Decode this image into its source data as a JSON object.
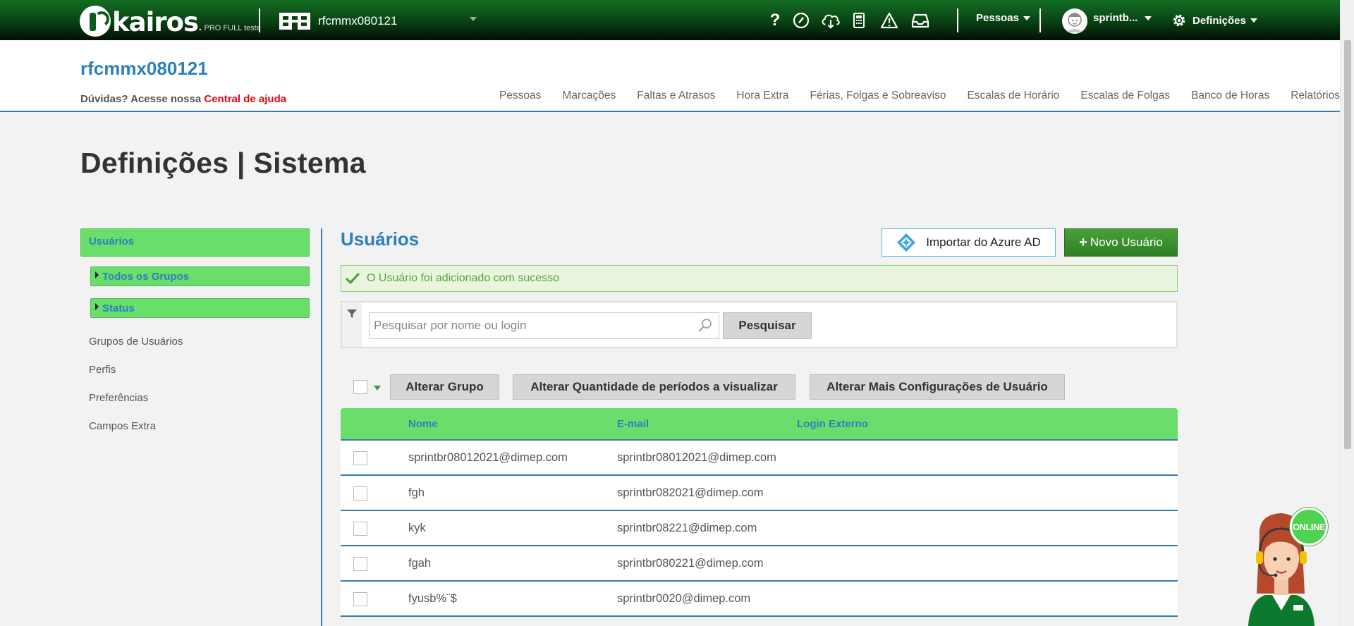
{
  "topbar": {
    "brand": "kairos",
    "brand_dot": ".",
    "edition": "PRO FULL teste",
    "company_selector": "rfcmmx080121",
    "icons": [
      "help-icon",
      "support-icon",
      "cloud-download-icon",
      "calculator-icon",
      "warning-icon",
      "inbox-icon"
    ],
    "help_glyph": "?",
    "people_menu": "Pessoas",
    "user_menu": "sprintb...",
    "settings_menu": "Definições"
  },
  "header": {
    "company": "rfcmmx080121",
    "help_text": "Dúvidas? Acesse nossa",
    "help_link": "Central de ajuda",
    "nav": [
      "Pessoas",
      "Marcações",
      "Faltas e Atrasos",
      "Hora Extra",
      "Férias, Folgas e Sobreaviso",
      "Escalas de Horário",
      "Escalas de Folgas",
      "Banco de Horas",
      "Relatórios"
    ]
  },
  "page": {
    "title": "Definições | Sistema"
  },
  "sidebar": {
    "active": "Usuários",
    "subitems": [
      "Todos os Grupos",
      "Status"
    ],
    "links": [
      "Grupos de Usuários",
      "Perfis",
      "Preferências",
      "Campos Extra"
    ]
  },
  "users": {
    "title": "Usuários",
    "import_button": "Importar do Azure AD",
    "new_button": "Novo Usuário",
    "alert": "O Usuário foi adicionado com sucesso",
    "search_placeholder": "Pesquisar por nome ou login",
    "search_button": "Pesquisar",
    "bulk_actions": [
      "Alterar Grupo",
      "Alterar Quantidade de períodos a visualizar",
      "Alterar Mais Configurações de Usuário"
    ],
    "columns": [
      "Nome",
      "E-mail",
      "Login Externo"
    ],
    "rows": [
      {
        "name": "sprintbr08012021@dimep.com",
        "email": "sprintbr08012021@dimep.com",
        "login": ""
      },
      {
        "name": "fgh",
        "email": "sprintbr082021@dimep.com",
        "login": ""
      },
      {
        "name": "kyk",
        "email": "sprintbr08221@dimep.com",
        "login": ""
      },
      {
        "name": "fgah",
        "email": "sprintbr080221@dimep.com",
        "login": ""
      },
      {
        "name": "fyusb%¨$",
        "email": "sprintbr0020@dimep.com",
        "login": ""
      }
    ]
  },
  "chat": {
    "status": "ONLINE"
  },
  "colors": {
    "brand_green": "#0b4a16",
    "accent_blue": "#2c7fbf",
    "highlight_green": "#6ade6a",
    "help_red": "#e30613"
  }
}
